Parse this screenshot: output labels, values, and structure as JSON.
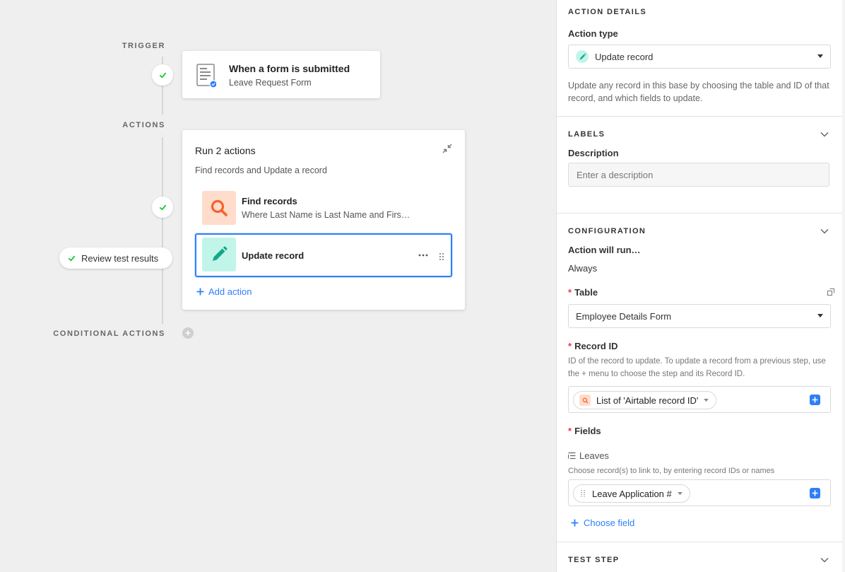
{
  "canvas": {
    "trigger_label": "TRIGGER",
    "actions_label": "ACTIONS",
    "conditional_label": "CONDITIONAL ACTIONS",
    "trigger": {
      "title": "When a form is submitted",
      "subtitle": "Leave Request Form",
      "icon": "form-icon"
    },
    "actions": {
      "title": "Run 2 actions",
      "subtitle": "Find records and Update a record",
      "steps": [
        {
          "title": "Find records",
          "subtitle": "Where Last Name is Last Name and Firs…",
          "icon": "search-icon",
          "color": "#f4632b"
        },
        {
          "title": "Update record",
          "icon": "pencil-icon",
          "color": "#11a889"
        }
      ],
      "add_action_label": "Add action"
    },
    "review_test_results": "Review test results"
  },
  "panel": {
    "action_details": {
      "title": "ACTION DETAILS",
      "action_type_label": "Action type",
      "action_type_value": "Update record",
      "description": "Update any record in this base by choosing the table and ID of that record, and which fields to update."
    },
    "labels": {
      "title": "LABELS",
      "description_label": "Description",
      "description_placeholder": "Enter a description"
    },
    "configuration": {
      "title": "CONFIGURATION",
      "action_will_run_label": "Action will run…",
      "action_will_run_value": "Always",
      "table_label": "Table",
      "table_value": "Employee Details Form",
      "record_id_label": "Record ID",
      "record_id_help": "ID of the record to update. To update a record from a previous step, use the + menu to choose the step and its Record ID.",
      "record_id_token": "List of 'Airtable record ID'",
      "fields_label": "Fields",
      "leaves_label": "Leaves",
      "leaves_help": "Choose record(s) to link to, by entering record IDs or names",
      "leaves_token": "Leave Application #",
      "choose_field_label": "Choose field"
    },
    "test_step": {
      "title": "TEST STEP"
    }
  },
  "colors": {
    "accent": "#2d7ff9",
    "success": "#20c933",
    "required": "#e8394d"
  }
}
